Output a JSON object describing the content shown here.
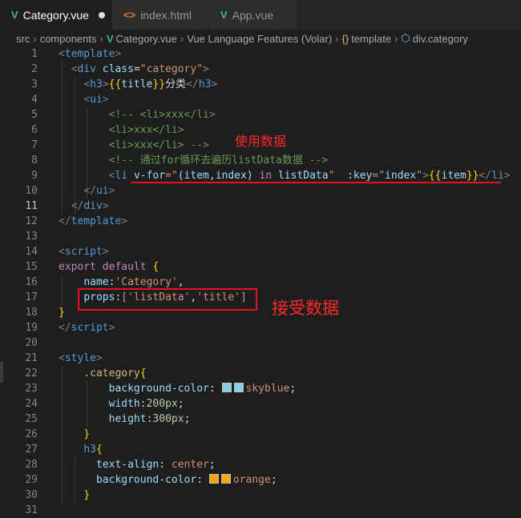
{
  "tabs": [
    {
      "label": "Category.vue",
      "icon": "V",
      "modified": true
    },
    {
      "label": "index.html",
      "icon": "<>"
    },
    {
      "label": "App.vue",
      "icon": "V"
    }
  ],
  "breadcrumb": [
    "src",
    "components",
    "Category.vue",
    "Vue Language Features (Volar)",
    "template",
    "div.category"
  ],
  "current_line": 11,
  "line_numbers": [
    "1",
    "2",
    "3",
    "4",
    "5",
    "6",
    "7",
    "8",
    "9",
    "10",
    "11",
    "12",
    "13",
    "14",
    "15",
    "16",
    "17",
    "18",
    "19",
    "20",
    "21",
    "22",
    "23",
    "24",
    "25",
    "26",
    "27",
    "28",
    "29",
    "30",
    "31"
  ],
  "code": {
    "l1a": "<",
    "l1b": "template",
    "l1c": ">",
    "l2a": "<",
    "l2b": "div",
    "l2c": "class",
    "l2d": "=",
    "l2e": "\"category\"",
    "l2f": ">",
    "l3a": "<",
    "l3b": "h3",
    "l3c": ">",
    "l3d": "{{",
    "l3e": "title",
    "l3f": "}}",
    "l3g": "分类",
    "l3h": "</",
    "l3i": "h3",
    "l3j": ">",
    "l4a": "<",
    "l4b": "ui",
    "l4c": ">",
    "l5": "<!-- <li>xxx</li>",
    "l6a": "<",
    "l6b": "li",
    "l6c": ">",
    "l6d": "xxx",
    "l6e": "</",
    "l6f": "li",
    "l6g": ">",
    "l7a": "<",
    "l7b": "li",
    "l7c": ">",
    "l7d": "xxx",
    "l7e": "</",
    "l7f": "li",
    "l7g": ">",
    "l7h": " -->",
    "l8": "<!-- 通过for循环去遍历listData数据 -->",
    "l9a": "<",
    "l9b": "li",
    "l9c": "v-for",
    "l9d": "=\"",
    "l9e": "(item,index)",
    "l9f": " in ",
    "l9g": "listData",
    "l9h": "\"",
    "l9i": ":key",
    "l9j": "=\"",
    "l9k": "index",
    "l9l": "\"",
    "l9m": ">",
    "l9n": "{{",
    "l9o": "item",
    "l9p": "}}",
    "l9q": "</",
    "l9r": "li",
    "l9s": ">",
    "l10a": "</",
    "l10b": "ui",
    "l10c": ">",
    "l11a": "</",
    "l11b": "div",
    "l11c": ">",
    "l12a": "</",
    "l12b": "template",
    "l12c": ">",
    "l14a": "<",
    "l14b": "script",
    "l14c": ">",
    "l15a": "export",
    "l15b": "default",
    "l15c": "{",
    "l16a": "name",
    "l16b": ":",
    "l16c": "'Category'",
    "l16d": ",",
    "l17a": "props",
    "l17b": ":",
    "l17c": "[",
    "l17d": "'listData'",
    "l17e": ",",
    "l17f": "'title'",
    "l17g": "]",
    "l18": "}",
    "l19a": "</",
    "l19b": "script",
    "l19c": ">",
    "l21a": "<",
    "l21b": "style",
    "l21c": ">",
    "l22a": ".category",
    "l22b": "{",
    "l23a": "background-color",
    "l23b": ":",
    "l23c": "skyblue",
    "l23d": ";",
    "l24a": "width",
    "l24b": ":",
    "l24c": "200px",
    "l24d": ";",
    "l25a": "height",
    "l25b": ":",
    "l25c": "300px",
    "l25d": ";",
    "l26": "}",
    "l27a": "h3",
    "l27b": "{",
    "l28a": "text-align",
    "l28b": ":",
    "l28c": "center",
    "l28d": ";",
    "l29a": "background-color",
    "l29b": ":",
    "l29c": "orange",
    "l29d": ";",
    "l30": "}"
  },
  "annotations": {
    "use_data": "使用数据",
    "receive_data": "接受数据"
  },
  "colors": {
    "skyblue": "#87ceeb",
    "orange": "#ffa500",
    "annotation": "#ff2a2a"
  }
}
